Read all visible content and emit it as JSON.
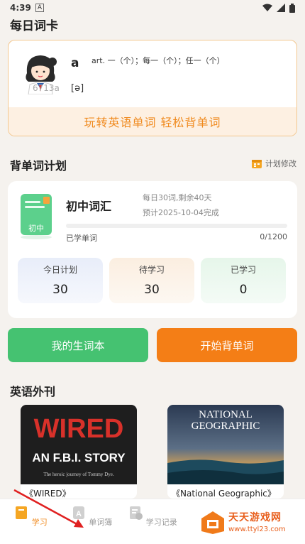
{
  "status_bar": {
    "time": "4:39",
    "notification_label": "A"
  },
  "app_title": "每日词卡",
  "daily_word": {
    "word": "a",
    "meaning": "art. 一（个）；每一（个）；任一（个）",
    "phonetic": "[ə]",
    "watermark": "6713a",
    "slogan": "玩转英语单词  轻松背单词"
  },
  "plan_section": {
    "title": "背单词计划",
    "edit_label": "计划修改",
    "book_label": "初中",
    "plan_name": "初中词汇",
    "daily_info": "每日30词,剩余40天",
    "finish_info": "预计2025-10-04完成",
    "learned_label": "已学单词",
    "learned_count": "0/1200",
    "progress": 0,
    "stats": [
      {
        "label": "今日计划",
        "value": "30"
      },
      {
        "label": "待学习",
        "value": "30"
      },
      {
        "label": "已学习",
        "value": "0"
      }
    ]
  },
  "buttons": {
    "vocab_book": "我的生词本",
    "start": "开始背单词"
  },
  "magazine_section": {
    "title": "英语外刊",
    "items": [
      {
        "caption": "《WIRED》",
        "cover_title": "WIRED",
        "cover_story": "AN F.B.I. STORY",
        "cover_subtitle": "The heroic journey of Tommy Dye."
      },
      {
        "caption": "《National Geographic》",
        "cover_title_1": "NATIONAL",
        "cover_title_2": "GEOGRAPHIC"
      }
    ]
  },
  "tabs": [
    {
      "label": "学习",
      "icon": "book-icon",
      "active": true
    },
    {
      "label": "单词簿",
      "icon": "word-book-icon",
      "icon_letter": "A",
      "active": false
    },
    {
      "label": "学习记录",
      "icon": "record-icon",
      "active": false
    }
  ],
  "ad_watermark": {
    "brand": "天天游戏网",
    "url": "www.ttyl23.com"
  },
  "colors": {
    "accent": "#f08a1e",
    "green": "#45c271",
    "orange": "#f47e16",
    "background": "#f5f2ee"
  }
}
